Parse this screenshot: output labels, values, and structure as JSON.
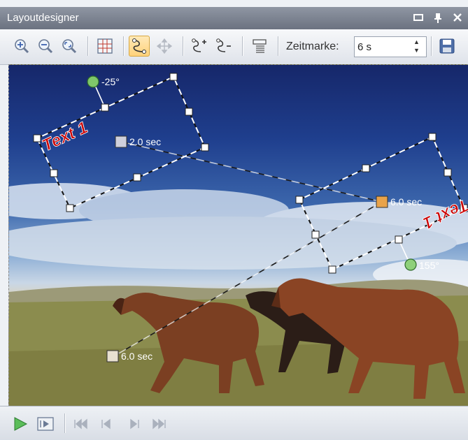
{
  "window": {
    "title": "Layoutdesigner"
  },
  "toolbar": {
    "zeitmarke_label": "Zeitmarke:",
    "zeitmarke_value": "6 s"
  },
  "canvas": {
    "text_object_1": "Text 1",
    "text_object_2": "Text 1",
    "rotation_1": "-25°",
    "rotation_2": "155°",
    "keyframe_1": "2.0 sec",
    "keyframe_2": "6.0 sec",
    "keyframe_3": "6.0 sec"
  },
  "colors": {
    "text_object": "#cc0000",
    "selection_outline": "#ffffff",
    "rotation_handle": "#7fc66a",
    "keyframe_active": "#e9a34a",
    "keyframe_inactive": "#e8e0d0"
  },
  "icons": {
    "toolbar": [
      "zoom-in-icon",
      "zoom-out-icon",
      "zoom-fit-icon",
      "grid-icon",
      "motion-path-icon",
      "move-icon",
      "add-keyframe-icon",
      "remove-keyframe-icon",
      "properties-icon",
      "save-icon"
    ],
    "bottombar": [
      "play-icon",
      "play-selection-icon",
      "first-frame-icon",
      "previous-frame-icon",
      "next-frame-icon",
      "last-frame-icon"
    ]
  }
}
